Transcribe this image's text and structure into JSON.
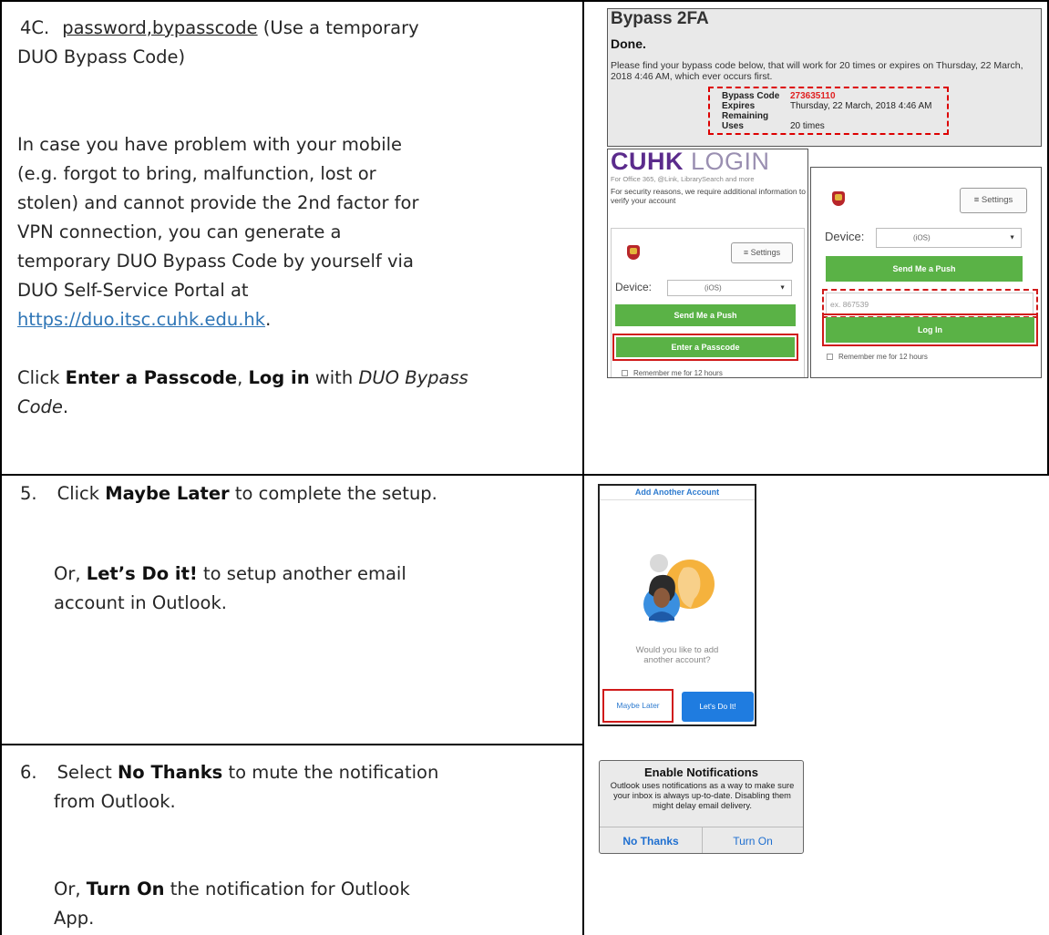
{
  "step4c": {
    "num": "4C.",
    "method": "password,bypasscode",
    "method_note": " (Use a temporary",
    "method_note2": "DUO Bypass Code)",
    "para_lines": [
      "In case you have problem with your mobile",
      "(e.g. forgot to bring, malfunction, lost or",
      "stolen) and cannot provide the 2nd factor for",
      "VPN connection, you can generate a",
      "temporary DUO Bypass Code by yourself via",
      "DUO Self-Service Portal at"
    ],
    "url": "https://duo.itsc.cuhk.edu.hk",
    "url_end": ".",
    "click": "Click ",
    "enter_passcode": "Enter a Passcode",
    "comma": ", ",
    "log_in": "Log in",
    "with": " with ",
    "duo_bypass": "DUO Bypass",
    "code": "Code",
    "period": "."
  },
  "bypass_panel": {
    "title": "Bypass 2FA",
    "done": "Done.",
    "message": "Please find your bypass code below, that will work for 20 times or expires on Thursday, 22 March, 2018 4:46 AM, which ever occurs first.",
    "bypass_code_label": "Bypass Code",
    "bypass_code_value": "273635110",
    "expires_label": "Expires",
    "expires_value": "Thursday, 22 March, 2018 4:46 AM",
    "remaining_label": "Remaining Uses",
    "remaining_value": "20 times"
  },
  "login_panel": {
    "brand_bold": "CUHK",
    "brand_light": " LOGIN",
    "subtitle": "For Office 365, @Link, LibrarySearch and more",
    "security_text": "For security reasons, we require additional information to verify your account",
    "settings_label": "≡  Settings",
    "device_label": "Device:",
    "device_value": "(iOS)",
    "send_push": "Send Me a Push",
    "enter_passcode": "Enter a Passcode",
    "remember": "Remember me for 12 hours"
  },
  "passcode_panel": {
    "settings_label": "≡  Settings",
    "device_label": "Device:",
    "device_value": "(iOS)",
    "send_push": "Send Me a Push",
    "passcode_placeholder": "ex. 867539",
    "log_in": "Log In",
    "remember": "Remember me for 12 hours"
  },
  "step5": {
    "num": "5.",
    "click": "Click ",
    "maybe_later": "Maybe Later",
    "rest": " to complete the setup.",
    "or": "Or, ",
    "lets_do": "Let’s Do it!",
    "rest2": " to setup another email",
    "rest3": "account in Outlook."
  },
  "add_account_panel": {
    "header": "Add Another Account",
    "question_line1": "Would you like to add",
    "question_line2": "another account?",
    "maybe_later": "Maybe Later",
    "lets_do": "Let's Do It!"
  },
  "step6": {
    "num": "6.",
    "select": "Select ",
    "no_thanks": "No Thanks",
    "rest": " to mute the notification",
    "rest2": "from Outlook.",
    "or": "Or, ",
    "turn_on": "Turn On",
    "rest3": " the notification for Outlook",
    "rest4": "App."
  },
  "notif_panel": {
    "title": "Enable Notifications",
    "body": "Outlook uses notifications as a way to make sure your inbox is always up-to-date. Disabling them might delay email delivery.",
    "no_thanks": "No Thanks",
    "turn_on": "Turn On"
  },
  "colors": {
    "link": "#2e75b6",
    "duo_green": "#5ab246",
    "cuhk_purple": "#5b2b8c",
    "highlight_red": "#d01a1a",
    "outlook_blue": "#1f7ce0"
  }
}
